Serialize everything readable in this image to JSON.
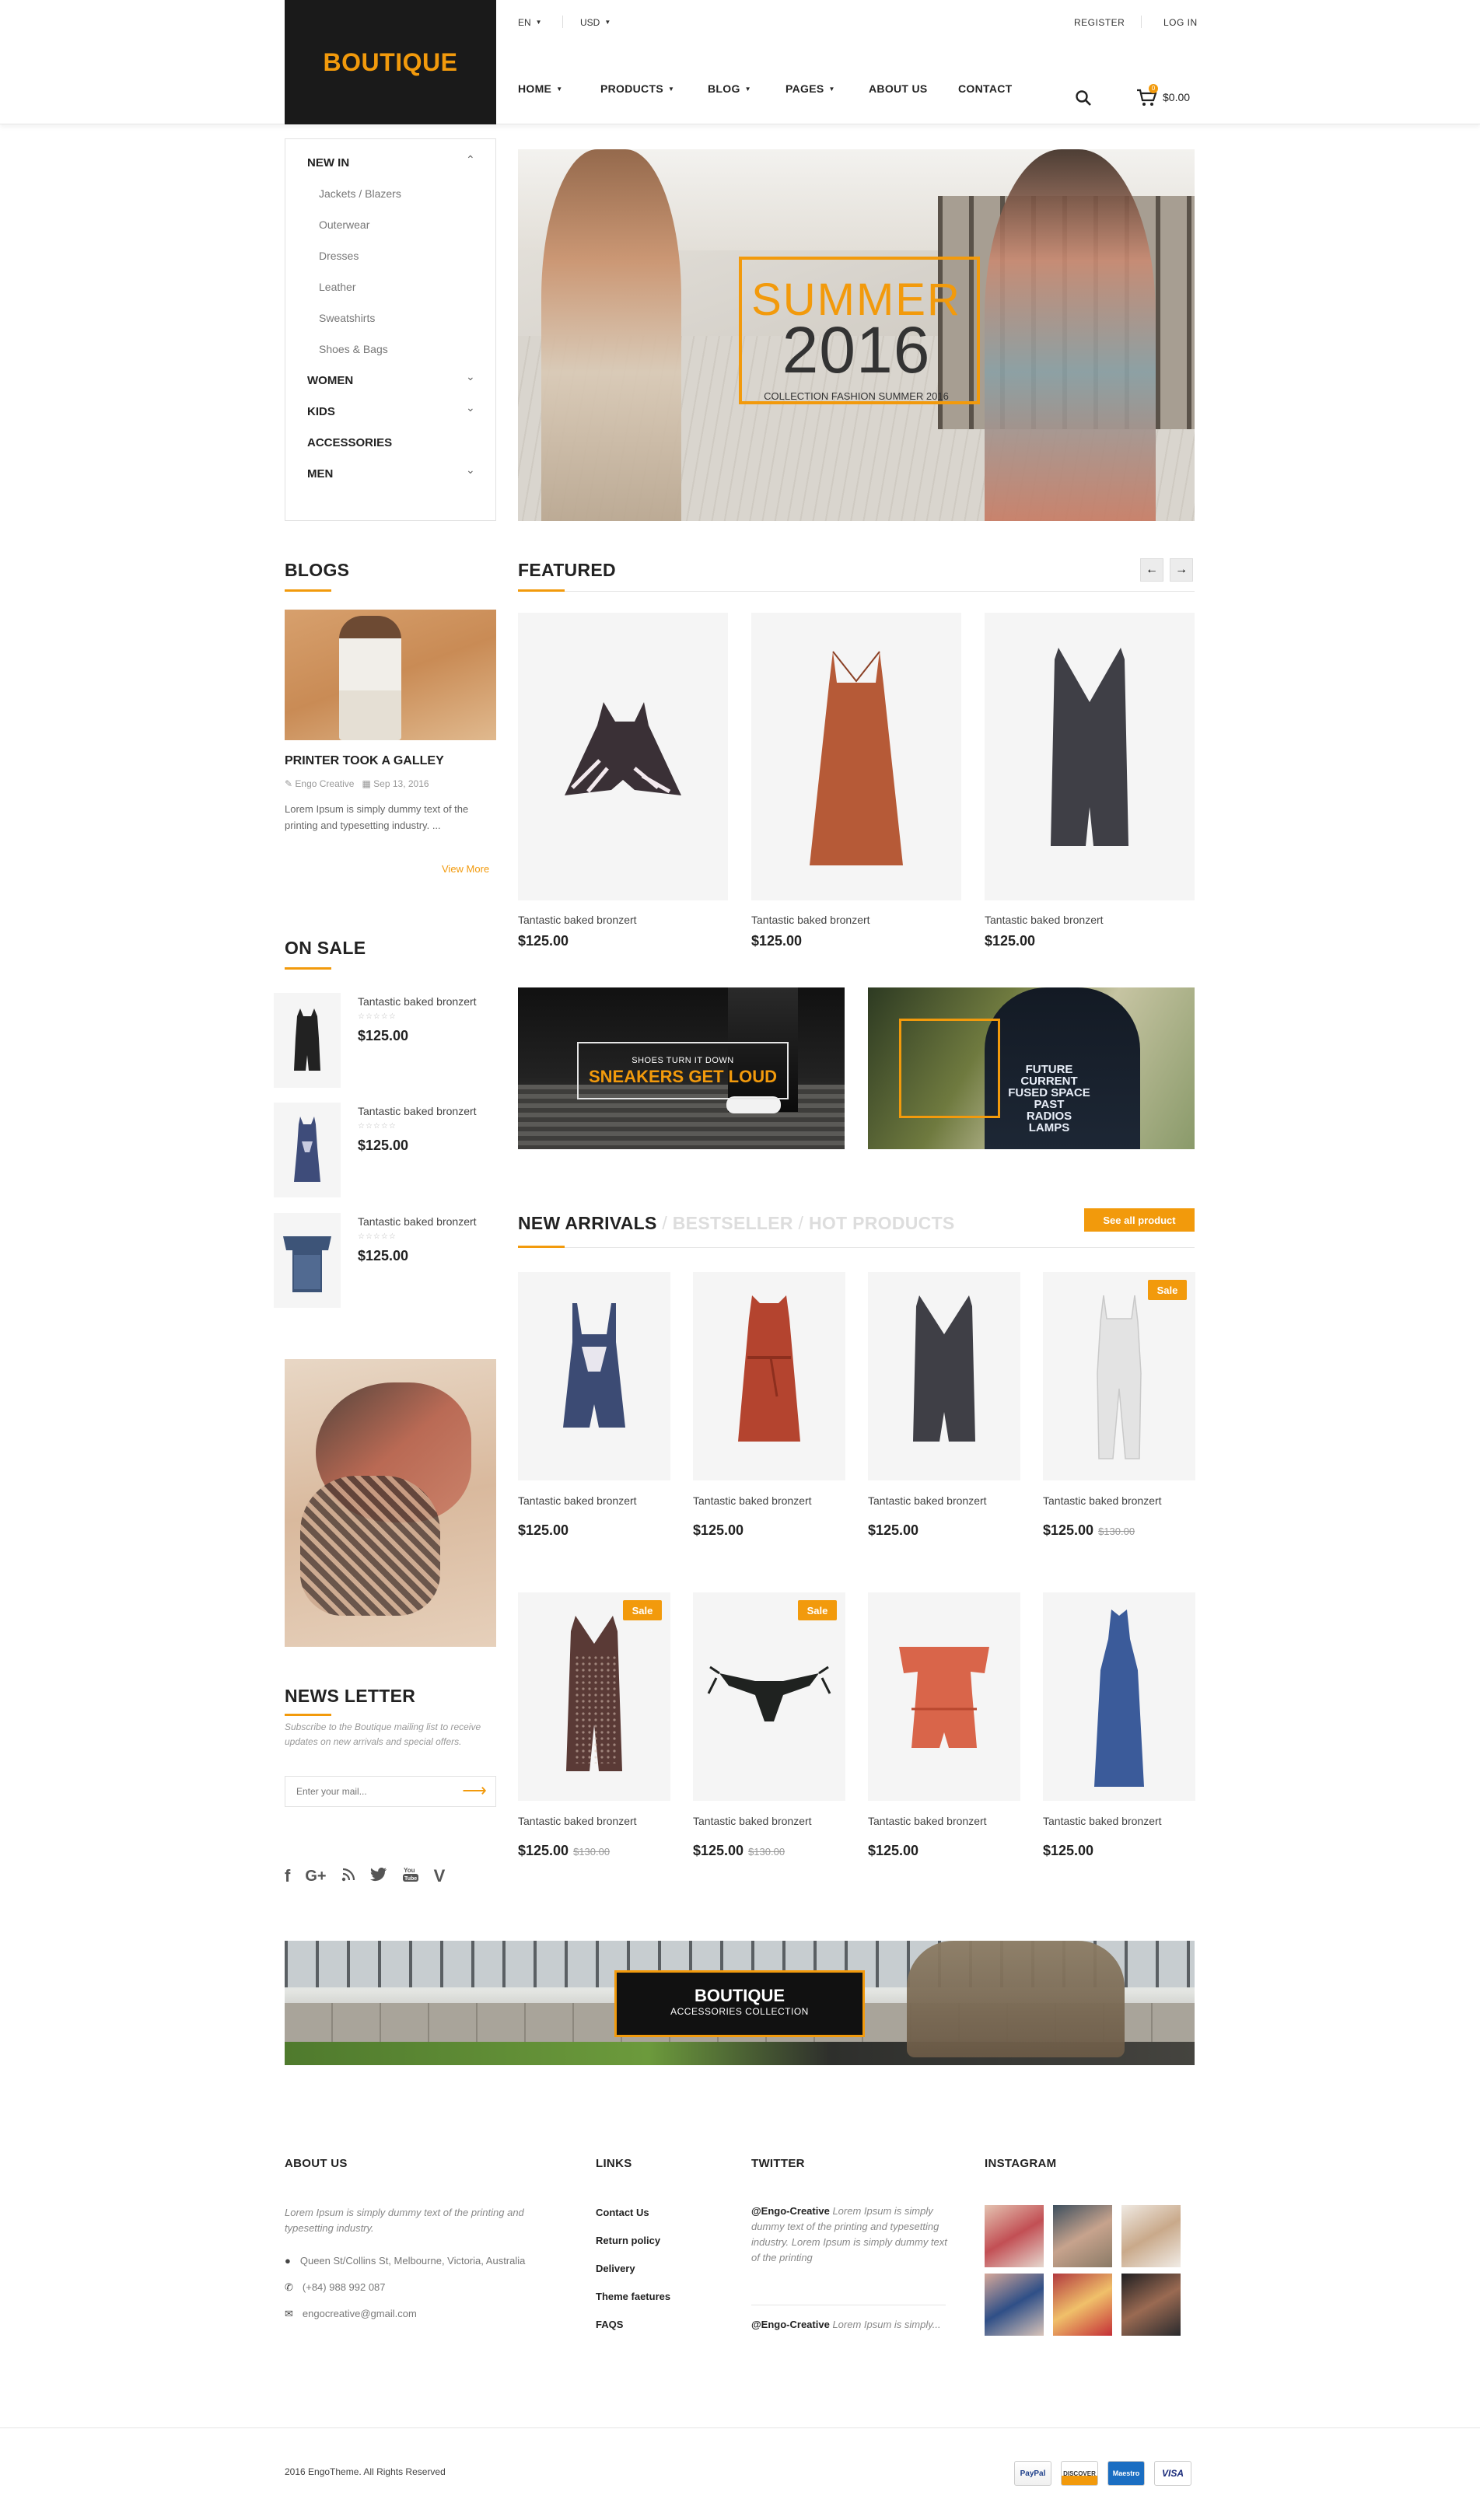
{
  "header": {
    "logo": "BOUTIQUE",
    "language": "EN",
    "currency": "USD",
    "register": "REGISTER",
    "login": "LOG IN",
    "nav": [
      "HOME",
      "PRODUCTS",
      "BLOG",
      "PAGES",
      "ABOUT US",
      "CONTACT"
    ],
    "cart_total": "$0.00",
    "cart_count": "0"
  },
  "category_menu": {
    "active": "NEW IN",
    "sub_items": [
      "Jackets / Blazers",
      "Outerwear",
      "Dresses",
      "Leather",
      "Sweatshirts",
      "Shoes & Bags"
    ],
    "groups": [
      "WOMEN",
      "KIDS",
      "ACCESSORIES",
      "MEN"
    ]
  },
  "hero": {
    "headline": "SUMMER",
    "year": "2016",
    "subtitle": "COLLECTION FASHION SUMMER 2016"
  },
  "blogs": {
    "title": "BLOGS",
    "post_title": "PRINTER TOOK A GALLEY",
    "author": "Engo Creative",
    "date": "Sep 13, 2016",
    "excerpt": "Lorem Ipsum is simply dummy text of the printing and typesetting industry. ...",
    "view_more": "View More"
  },
  "on_sale": {
    "title": "ON SALE",
    "items": [
      {
        "name": "Tantastic baked bronzert",
        "stars": "☆☆☆☆☆",
        "price": "$125.00"
      },
      {
        "name": "Tantastic baked bronzert",
        "stars": "☆☆☆☆☆",
        "price": "$125.00"
      },
      {
        "name": "Tantastic baked bronzert",
        "stars": "☆☆☆☆☆",
        "price": "$125.00"
      }
    ]
  },
  "featured": {
    "title": "FEATURED",
    "prev": "←",
    "next": "→",
    "products": [
      {
        "name": "Tantastic baked bronzert",
        "price": "$125.00"
      },
      {
        "name": "Tantastic baked bronzert",
        "price": "$125.00"
      },
      {
        "name": "Tantastic baked bronzert",
        "price": "$125.00"
      }
    ]
  },
  "promo_banners": {
    "left_small": "SHOES TURN IT DOWN",
    "left_big": "SNEAKERS GET LOUD",
    "right_jacket_text": [
      "FUTURE",
      "CURRENT",
      "FUSED SPACE",
      "PAST",
      "RADIOS",
      "LAMPS"
    ]
  },
  "arrivals": {
    "tabs": [
      "NEW ARRIVALS",
      "BESTSELLER",
      "HOT PRODUCTS"
    ],
    "separator": "/",
    "see_all": "See all product",
    "sale_label": "Sale",
    "products": [
      {
        "name": "Tantastic baked bronzert",
        "price": "$125.00",
        "old_price": ""
      },
      {
        "name": "Tantastic baked bronzert",
        "price": "$125.00",
        "old_price": ""
      },
      {
        "name": "Tantastic baked bronzert",
        "price": "$125.00",
        "old_price": ""
      },
      {
        "name": "Tantastic baked bronzert",
        "price": "$125.00",
        "old_price": "$130.00"
      },
      {
        "name": "Tantastic baked bronzert",
        "price": "$125.00",
        "old_price": "$130.00"
      },
      {
        "name": "Tantastic baked bronzert",
        "price": "$125.00",
        "old_price": "$130.00"
      },
      {
        "name": "Tantastic baked bronzert",
        "price": "$125.00",
        "old_price": ""
      },
      {
        "name": "Tantastic baked bronzert",
        "price": "$125.00",
        "old_price": ""
      }
    ]
  },
  "newsletter": {
    "title": "NEWS LETTER",
    "description": "Subscribe to the Boutique mailing list to receive updates on new arrivals and special offers.",
    "placeholder": "Enter your mail..."
  },
  "social_icons": [
    "facebook-icon",
    "google-plus-icon",
    "rss-icon",
    "twitter-icon",
    "youtube-icon",
    "vine-icon"
  ],
  "accessories_banner": {
    "title": "BOUTIQUE",
    "subtitle": "ACCESSORIES COLLECTION"
  },
  "footer": {
    "about_title": "ABOUT US",
    "about_text": "Lorem Ipsum is simply dummy text of the printing and typesetting industry.",
    "address": "Queen St/Collins St, Melbourne, Victoria, Australia",
    "phone": "(+84) 988 992 087",
    "email": "engocreative@gmail.com",
    "links_title": "LINKS",
    "links": [
      "Contact Us",
      "Return policy",
      "Delivery",
      "Theme faetures",
      "FAQS"
    ],
    "twitter_title": "TWITTER",
    "tweet1_handle": "@Engo-Creative",
    "tweet1_text": "Lorem Ipsum is simply dummy text of the printing and typesetting industry. Lorem Ipsum is simply dummy text of the printing",
    "tweet2_handle": "@Engo-Creative",
    "tweet2_text": "Lorem Ipsum is simply...",
    "instagram_title": "INSTAGRAM",
    "copyright": "2016 EngoTheme. All Rights Reserved",
    "payments": [
      "PayPal",
      "DISCOVER",
      "Maestro",
      "VISA"
    ]
  },
  "colors": {
    "accent": "#f29a0c",
    "dark": "#1a1a1a"
  }
}
